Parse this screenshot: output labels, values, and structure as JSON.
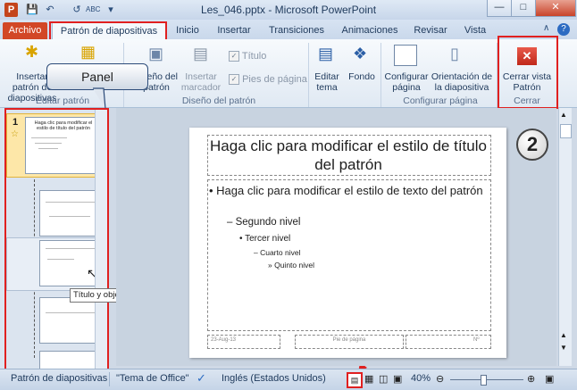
{
  "window": {
    "title": "Les_046.pptx - Microsoft PowerPoint",
    "app_icon_letter": "P",
    "quick_access": [
      "save-icon",
      "undo-icon",
      "redo-icon",
      "spelling-icon",
      "customize-icon"
    ],
    "controls": [
      "minimize-icon",
      "maximize-icon",
      "close-icon"
    ]
  },
  "tabs": [
    {
      "label": "Archivo"
    },
    {
      "label": "Patrón de diapositivas"
    },
    {
      "label": "Inicio"
    },
    {
      "label": "Insertar"
    },
    {
      "label": "Transiciones"
    },
    {
      "label": "Animaciones"
    },
    {
      "label": "Revisar"
    },
    {
      "label": "Vista"
    }
  ],
  "ribbon": {
    "insert_master": "Insertar patrón de diapositivas",
    "insert_layout": "diseño",
    "rename": "diseño del patrón",
    "insert_placeholder": "Insertar marcador",
    "title_check": "Título",
    "footer_check": "Pies de página",
    "edit_theme": "Editar tema",
    "background": "Fondo",
    "page_setup": "Configurar página",
    "orientation": "Orientación de la diapositiva",
    "close_view": "Cerrar vista Patrón",
    "groups": {
      "editar_patron": "Editar patrón",
      "diseno_patron": "Diseño del patrón",
      "configurar_pagina": "Configurar página",
      "cerrar": "Cerrar"
    }
  },
  "panel": {
    "callout_label": "Panel",
    "slide_number": "1",
    "thumb_title": "Haga clic para modificar el estilo de título del patrón",
    "tooltip": "Título y objetos Diseño: que utilizan las diapositivas 2-4, 6-8, 12"
  },
  "slide": {
    "title": "Haga clic para modificar el estilo de título del patrón",
    "level1": "Haga clic para modificar el estilo de texto del patrón",
    "level2": "Segundo nivel",
    "level3": "Tercer nivel",
    "level4": "Cuarto nivel",
    "level5": "Quinto nivel",
    "footer_date": "23-Aug-13",
    "footer_center": "Pie de página",
    "footer_num": "Nº"
  },
  "callouts": {
    "one": "1",
    "two": "2"
  },
  "statusbar": {
    "view": "Patrón de diapositivas",
    "theme": "\"Tema de Office\"",
    "language": "Inglés (Estados Unidos)",
    "zoom": "40%"
  },
  "colors": {
    "accent_red": "#e02020",
    "file_tab": "#d24726"
  }
}
